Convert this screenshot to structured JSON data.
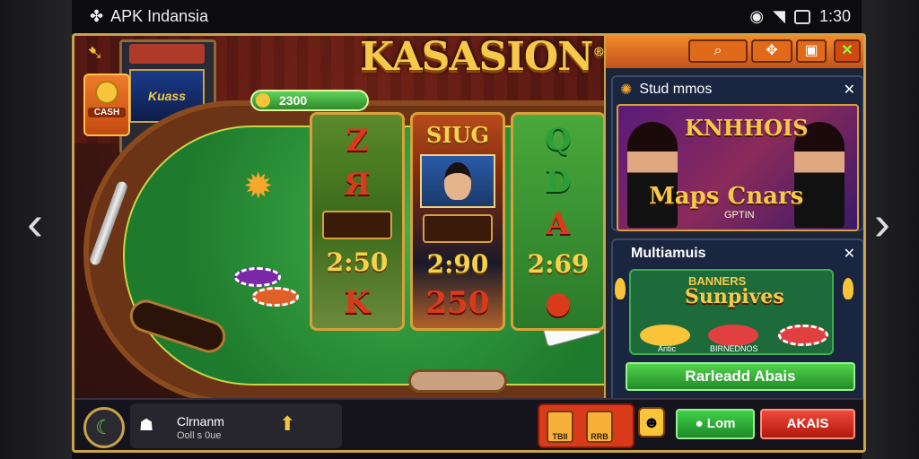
{
  "statusbar": {
    "app_title": "APK Indansia",
    "time": "1:30"
  },
  "game": {
    "title": "KASASION",
    "title_mark": "®",
    "cabinet_text": "Kuass",
    "left_badge_label": "CASH",
    "bet_value": "2300",
    "reels": [
      {
        "top": "Z",
        "mid_box": "",
        "value": "2:50",
        "bottom": "K"
      },
      {
        "top": "SIUG",
        "value": "2:90",
        "bottom": "250"
      },
      {
        "top": "Q",
        "mid": "D",
        "mid2": "A",
        "value": "2:69"
      }
    ]
  },
  "panel": {
    "promo_header": "Stud mmos",
    "promo_title_top": "KNHHOIS",
    "promo_title_bottom": "Maps Cnars",
    "promo_sub": "GPTIN",
    "multi_header": "Multiamuis",
    "multi_sub_top": "BANNERS",
    "multi_title": "Sunpives",
    "multi_captions": [
      "Antic",
      "BIRNEDNOS"
    ],
    "redeem_label": "Rarleadd Abais"
  },
  "bottombar": {
    "user_name": "Clrnanm",
    "user_sub": "Ooll s 0ue",
    "game_labels": [
      "TBII",
      "RRB",
      ""
    ],
    "join_label": "Lom",
    "red_label": "AKAIS"
  },
  "colors": {
    "accent_gold": "#c9a24a",
    "green": "#2e8a2a",
    "red": "#d83a1a",
    "panel_bg": "#1c2436"
  }
}
